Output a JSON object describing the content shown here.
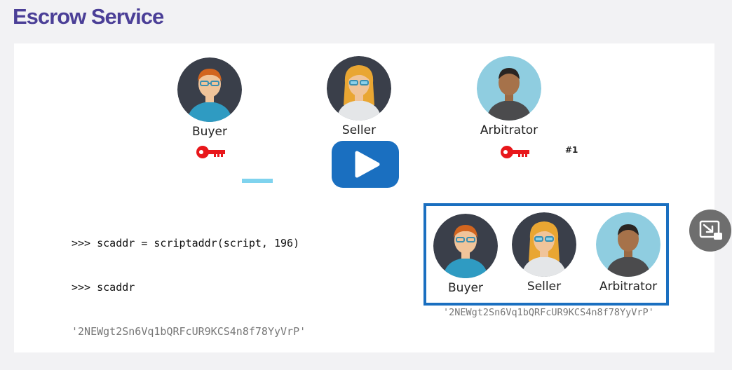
{
  "header": {
    "title": "Escrow Service"
  },
  "parties": [
    {
      "label": "Buyer",
      "icon": "buyer-avatar-icon"
    },
    {
      "label": "Seller",
      "icon": "seller-avatar-icon"
    },
    {
      "label": "Arbitrator",
      "icon": "arbitrator-avatar-icon"
    }
  ],
  "keys": {
    "icon": "key-icon",
    "color": "#e8171b"
  },
  "arbitrator_note": "#1",
  "code": {
    "line1": ">>> scaddr = scriptaddr(script, 196)",
    "line2": ">>> scaddr",
    "output": "'2NEWgt2Sn6Vq1bQRFcUR9KCS4n8f78YyVrP'"
  },
  "multisig": {
    "members": [
      "Buyer",
      "Seller",
      "Arbitrator"
    ],
    "caption": "'2NEWgt2Sn6Vq1bQRFcUR9KCS4n8f78YyVrP'",
    "border_color": "#1a6fc0"
  },
  "controls": {
    "play": {
      "icon": "play-icon",
      "color": "#1a6fc0"
    },
    "pip": {
      "icon": "picture-in-picture-icon"
    }
  },
  "colors": {
    "title": "#4b3f97",
    "highlight": "#7fd3ee"
  }
}
